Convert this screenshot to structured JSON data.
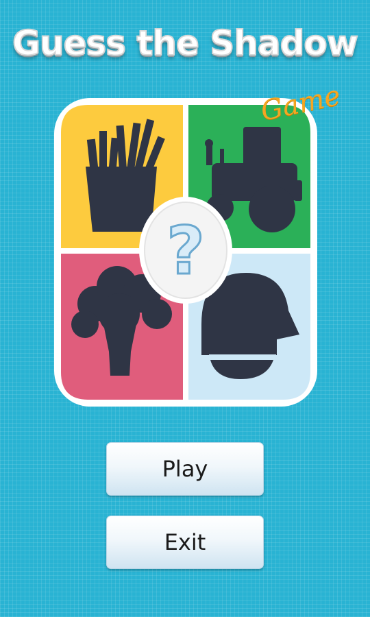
{
  "title": "Guess the Shadow",
  "subtitle_tag": "Game",
  "logo": {
    "center_symbol": "?",
    "tiles": [
      {
        "name": "fries-silhouette",
        "color": "#fdcb3e"
      },
      {
        "name": "tractor-silhouette",
        "color": "#2bb058"
      },
      {
        "name": "broccoli-silhouette",
        "color": "#e05d7c"
      },
      {
        "name": "helmet-silhouette",
        "color": "#cde8f7"
      }
    ],
    "silhouette_color": "#2f3545"
  },
  "buttons": {
    "play": "Play",
    "exit": "Exit"
  },
  "colors": {
    "background": "#29b3d3",
    "title_text": "#ffffff",
    "tag": "#f5a623"
  }
}
